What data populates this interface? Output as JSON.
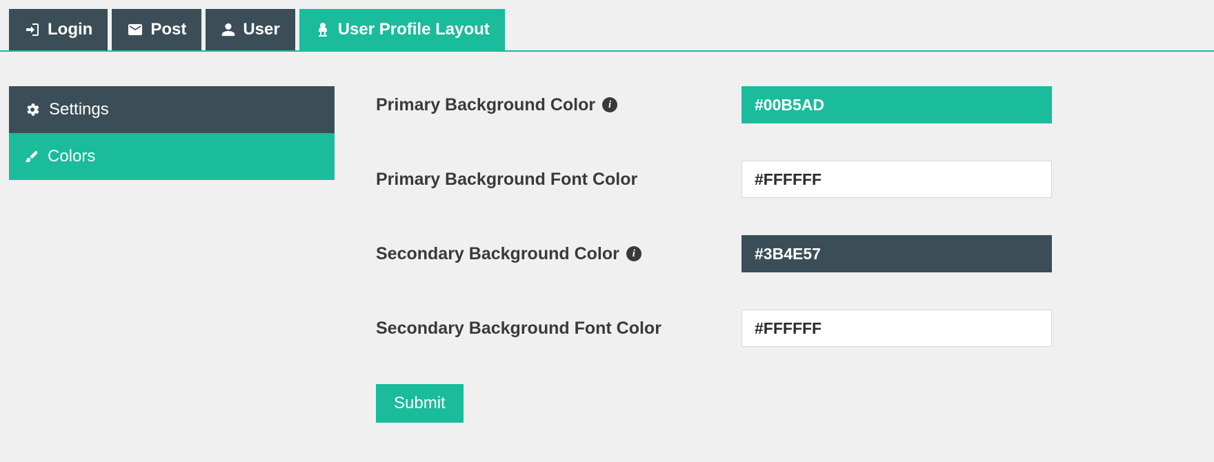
{
  "tabs": [
    {
      "label": "Login",
      "icon": "login-icon"
    },
    {
      "label": "Post",
      "icon": "envelope-icon"
    },
    {
      "label": "User",
      "icon": "user-icon"
    },
    {
      "label": "User Profile Layout",
      "icon": "profile-layout-icon",
      "active": true
    }
  ],
  "sidebar": {
    "items": [
      {
        "label": "Settings",
        "icon": "gears-icon"
      },
      {
        "label": "Colors",
        "icon": "brush-icon",
        "active": true
      }
    ]
  },
  "form": {
    "fields": [
      {
        "label": "Primary Background Color",
        "info": true,
        "value": "#00B5AD",
        "bg": "teal"
      },
      {
        "label": "Primary Background Font Color",
        "info": false,
        "value": "#FFFFFF",
        "bg": "white"
      },
      {
        "label": "Secondary Background Color",
        "info": true,
        "value": "#3B4E57",
        "bg": "dark"
      },
      {
        "label": "Secondary Background Font Color",
        "info": false,
        "value": "#FFFFFF",
        "bg": "white"
      }
    ],
    "submit_label": "Submit"
  }
}
